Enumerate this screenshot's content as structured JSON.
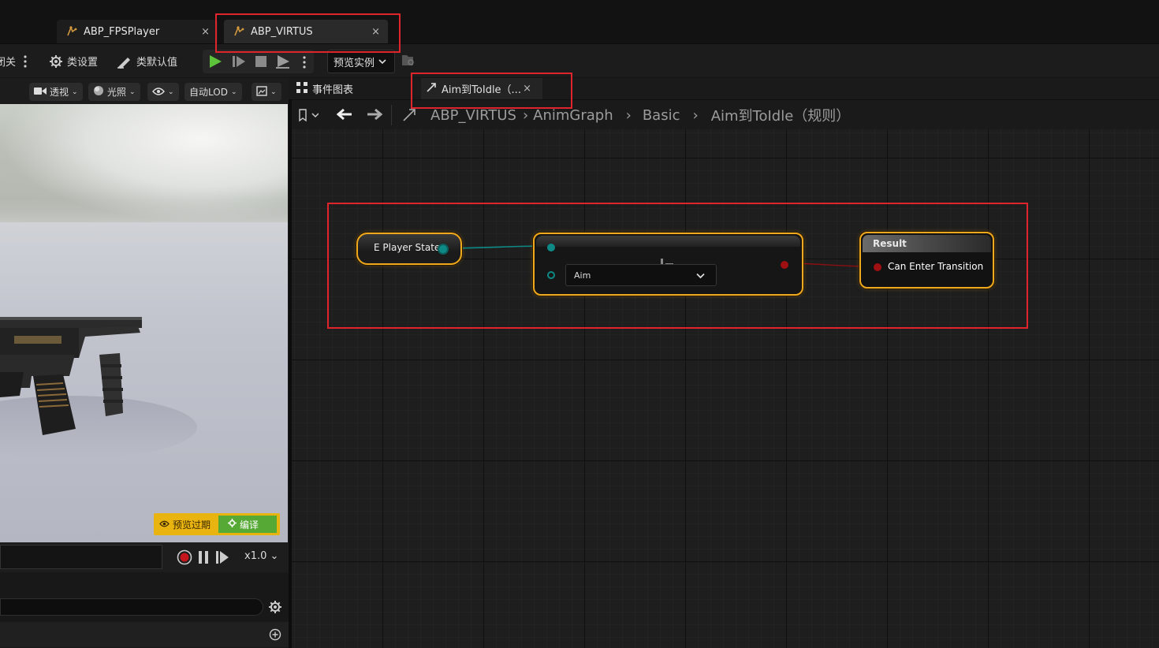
{
  "tabs": [
    {
      "label": "ABP_FPSPlayer",
      "close": "×"
    },
    {
      "label": "ABP_VIRTUS",
      "close": "×"
    }
  ],
  "toolbar": {
    "cut_label": "闭关",
    "class_settings": "类设置",
    "class_defaults": "类默认值",
    "preview_instance": "预览实例"
  },
  "viewport": {
    "perspective": "透视",
    "lighting": "光照",
    "lod": "自动LOD",
    "preview_expired": "预览过期",
    "compile": "编译",
    "speed": "x1.0"
  },
  "graph_tabs": {
    "event_graph": "事件图表",
    "active_tab": "Aim到ToIdle（...",
    "close": "×"
  },
  "breadcrumb": {
    "items": [
      "ABP_VIRTUS",
      "AnimGraph",
      "Basic",
      "Aim到ToIdle（规则）"
    ]
  },
  "nodes": {
    "variable_label": "E Player State",
    "enum_value": "Aim",
    "result_header": "Result",
    "result_pin": "Can Enter Transition"
  },
  "colors": {
    "node_outline": "#f0a81c",
    "enum_pin": "#0e8a86",
    "bool_pin": "#a00f12",
    "annotation": "#e0242c"
  }
}
